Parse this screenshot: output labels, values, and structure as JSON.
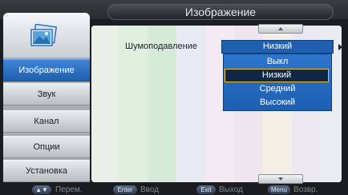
{
  "header": {
    "title": "Изображение"
  },
  "sidebar": {
    "logo_icon": "picture-icon",
    "items": [
      {
        "label": "Изображение",
        "active": true
      },
      {
        "label": "Звук",
        "active": false
      },
      {
        "label": "Канал",
        "active": false
      },
      {
        "label": "Опции",
        "active": false
      },
      {
        "label": "Установка",
        "active": false
      }
    ]
  },
  "main": {
    "setting": {
      "label": "Шумоподавление",
      "value": "Низкий",
      "options": [
        "Выкл",
        "Низкий",
        "Средний",
        "Высокий"
      ],
      "selected_option": "Низкий"
    }
  },
  "footer": {
    "hints": [
      {
        "key": "▲▼",
        "label": "Перем."
      },
      {
        "key": "Enter",
        "label": "Ввод"
      },
      {
        "key": "Exit",
        "label": "Выход"
      },
      {
        "key": "Menu",
        "label": "Возвр."
      }
    ]
  },
  "colors": {
    "accent": "#1f5fb0",
    "selection_border": "#f0c02a",
    "sidebar_active": "#2e72c4"
  }
}
